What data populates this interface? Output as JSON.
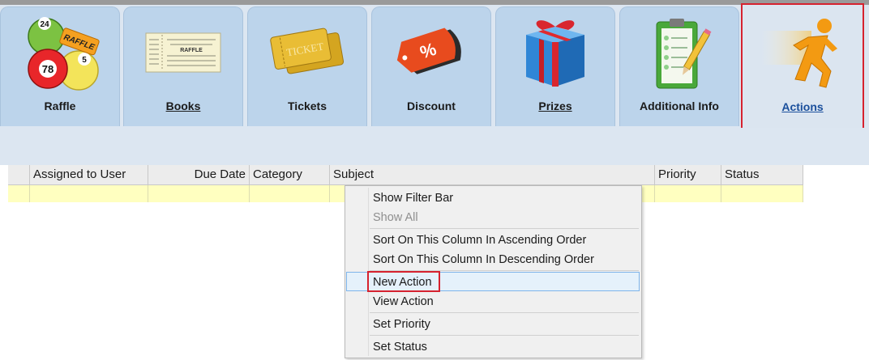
{
  "tabs": [
    {
      "id": "raffle",
      "label": "Raffle",
      "icon": "bingo-balls-icon",
      "active": false
    },
    {
      "id": "books",
      "label": "Books",
      "icon": "ticket-book-icon",
      "active": false
    },
    {
      "id": "tickets",
      "label": "Tickets",
      "icon": "tickets-icon",
      "active": false
    },
    {
      "id": "discount",
      "label": "Discount",
      "icon": "discount-tag-icon",
      "active": false
    },
    {
      "id": "prizes",
      "label": "Prizes",
      "icon": "gift-box-icon",
      "active": false
    },
    {
      "id": "additional",
      "label": "Additional Info",
      "icon": "clipboard-icon",
      "active": false
    },
    {
      "id": "actions",
      "label": "Actions",
      "icon": "running-man-icon",
      "active": true
    }
  ],
  "icon_text": {
    "ball1": "24",
    "ball2": "78",
    "ball3": "5",
    "raffle_sticker": "RAFFLE",
    "book_title": "RAFFLE",
    "ticket_text": "TICKET",
    "discount_sign": "%"
  },
  "grid": {
    "columns": [
      "Assigned to User",
      "Due Date",
      "Category",
      "Subject",
      "Priority",
      "Status"
    ]
  },
  "context_menu": {
    "items": [
      {
        "label": "Show Filter Bar",
        "enabled": true
      },
      {
        "label": "Show All",
        "enabled": false
      },
      {
        "label": "Sort On This Column In Ascending Order",
        "enabled": true
      },
      {
        "label": "Sort On This Column In Descending Order",
        "enabled": true
      },
      {
        "label": "New Action",
        "enabled": true,
        "highlighted": true
      },
      {
        "label": "View Action",
        "enabled": true
      },
      {
        "label": "Set Priority",
        "enabled": true
      },
      {
        "label": "Set Status",
        "enabled": true
      }
    ]
  },
  "colors": {
    "highlight_border": "#d6222f",
    "ribbon_bg": "#dce6f1",
    "tab_bg": "#bcd4eb",
    "row_bg": "#ffffc0"
  }
}
